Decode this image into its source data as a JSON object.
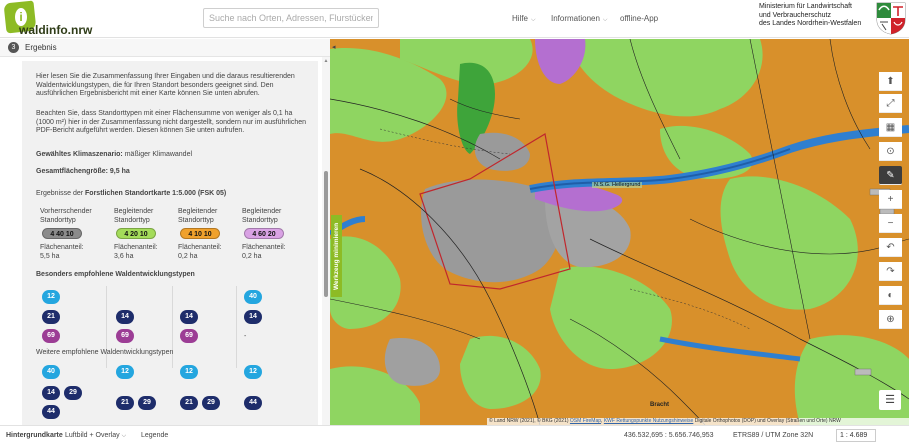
{
  "header": {
    "logo_text_main": "waldinfo",
    "logo_text_suffix": ".nrw",
    "search_placeholder": "Suche nach Orten, Adressen, Flurstücken, Karten, ...",
    "nav": [
      {
        "label": "Hilfe",
        "has_dropdown": true
      },
      {
        "label": "Informationen",
        "has_dropdown": true
      },
      {
        "label": "offline-App",
        "has_dropdown": false
      }
    ],
    "ministry_lines": [
      "Ministerium für Landwirtschaft",
      "und Verbraucherschutz",
      "des Landes Nordrhein-Westfalen"
    ]
  },
  "sidebar": {
    "step_number": "3",
    "step_label": "Ergebnis",
    "intro_text": "Hier lesen Sie die Zusammenfassung Ihrer Eingaben und die daraus resultierenden Waldentwicklungstypen, die für Ihren Standort besonders geeignet sind. Den ausführlichen Ergebnisbericht mit einer Karte können Sie unten abrufen.",
    "note_text": "Beachten Sie, dass Standorttypen mit einer Flächensumme von weniger als 0,1 ha (1000 m²) hier in der Zusammenfassung nicht dargestellt, sondern nur im ausführlichen PDF-Bericht aufgeführt werden. Diesen können Sie unten aufrufen.",
    "climate_label": "Gewähltes Klimaszenario:",
    "climate_value": "mäßiger Klimawandel",
    "area_label": "Gesamtflächengröße: 9,5 ha",
    "results_prefix": "Ergebnisse der ",
    "results_bold": "Forstlichen Standortkarte 1:5.000 (FSK 05)",
    "standort_columns": [
      {
        "type_line1": "Vorherrschender",
        "type_line2": "Standorttyp",
        "code": "4 40 10",
        "color": "#8b8b8b",
        "area_label": "Flächenanteil:",
        "area_value": "5,5 ha"
      },
      {
        "type_line1": "Begleitender",
        "type_line2": "Standorttyp",
        "code": "4 20 10",
        "color": "#a4dc5a",
        "area_label": "Flächenanteil:",
        "area_value": "3,6 ha"
      },
      {
        "type_line1": "Begleitender",
        "type_line2": "Standorttyp",
        "code": "4 10 10",
        "color": "#f0a12c",
        "area_label": "Flächenanteil:",
        "area_value": "0,2 ha"
      },
      {
        "type_line1": "Begleitender",
        "type_line2": "Standorttyp",
        "code": "4 60 20",
        "color": "#d9a2e4",
        "area_label": "Flächenanteil:",
        "area_value": "0,2 ha"
      }
    ],
    "recommended_heading": "Besonders empfohlene Waldentwicklungstypen",
    "recommended": {
      "col1": [
        "12",
        "21",
        "69"
      ],
      "col2": [
        "14",
        "69"
      ],
      "col3": [
        "14",
        "69"
      ],
      "col4": [
        "40",
        "14",
        "-"
      ]
    },
    "further_heading": "Weitere empfohlene Waldentwicklungstypen",
    "further": {
      "col1": [
        "40",
        "14",
        "29",
        "44"
      ],
      "col2": [
        "12",
        "21",
        "29"
      ],
      "col3": [
        "12",
        "21",
        "29"
      ],
      "col4": [
        "12",
        "44"
      ]
    }
  },
  "map": {
    "side_tab_label": "Werkzeug minimieren",
    "place_label": "N.S.G. Hellergrund",
    "place_label2": "Bracht",
    "toolbar": [
      {
        "icon": "compass-icon",
        "glyph": "⬆"
      },
      {
        "icon": "fullscreen-icon",
        "glyph": "⤢"
      },
      {
        "icon": "calendar-icon",
        "glyph": "▦"
      },
      {
        "icon": "location-pin-icon",
        "glyph": "⊙"
      },
      {
        "icon": "tools-icon",
        "glyph": "✎"
      },
      {
        "icon": "zoom-in-icon",
        "glyph": "+"
      },
      {
        "icon": "zoom-out-icon",
        "glyph": "−"
      },
      {
        "icon": "undo-icon",
        "glyph": "↶"
      },
      {
        "icon": "redo-icon",
        "glyph": "↷"
      },
      {
        "icon": "measure-icon",
        "glyph": "◐"
      },
      {
        "icon": "locate-icon",
        "glyph": "⊕"
      }
    ],
    "attribution_parts": [
      {
        "text": "© Land NRW (2021), © BKG (2021) ",
        "link": false
      },
      {
        "text": "OSM FireMap",
        "link": true
      },
      {
        "text": ", ",
        "link": false
      },
      {
        "text": "KWF Rettungspunkte Nutzungshinweise",
        "link": true
      },
      {
        "text": "     Digitale Orthophotos (DOP) und Overlay (Straßen und Orte) NRW",
        "link": false
      }
    ]
  },
  "bottombar": {
    "background_label": "Hintergrundkarte",
    "background_value": "Luftbild + Overlay",
    "legend_label": "Legende",
    "coordinates": "436.532,695 : 5.656.746,953",
    "projection": "ETRS89 / UTM Zone 32N",
    "scale": "1 : 4.689"
  },
  "colors": {
    "brand_green": "#8dbb25",
    "map_orange": "#d8902b",
    "map_lightgreen": "#8fd561",
    "map_grey": "#9a9a9a",
    "map_purple": "#b46fd0",
    "map_blue": "#2f7fd0"
  }
}
